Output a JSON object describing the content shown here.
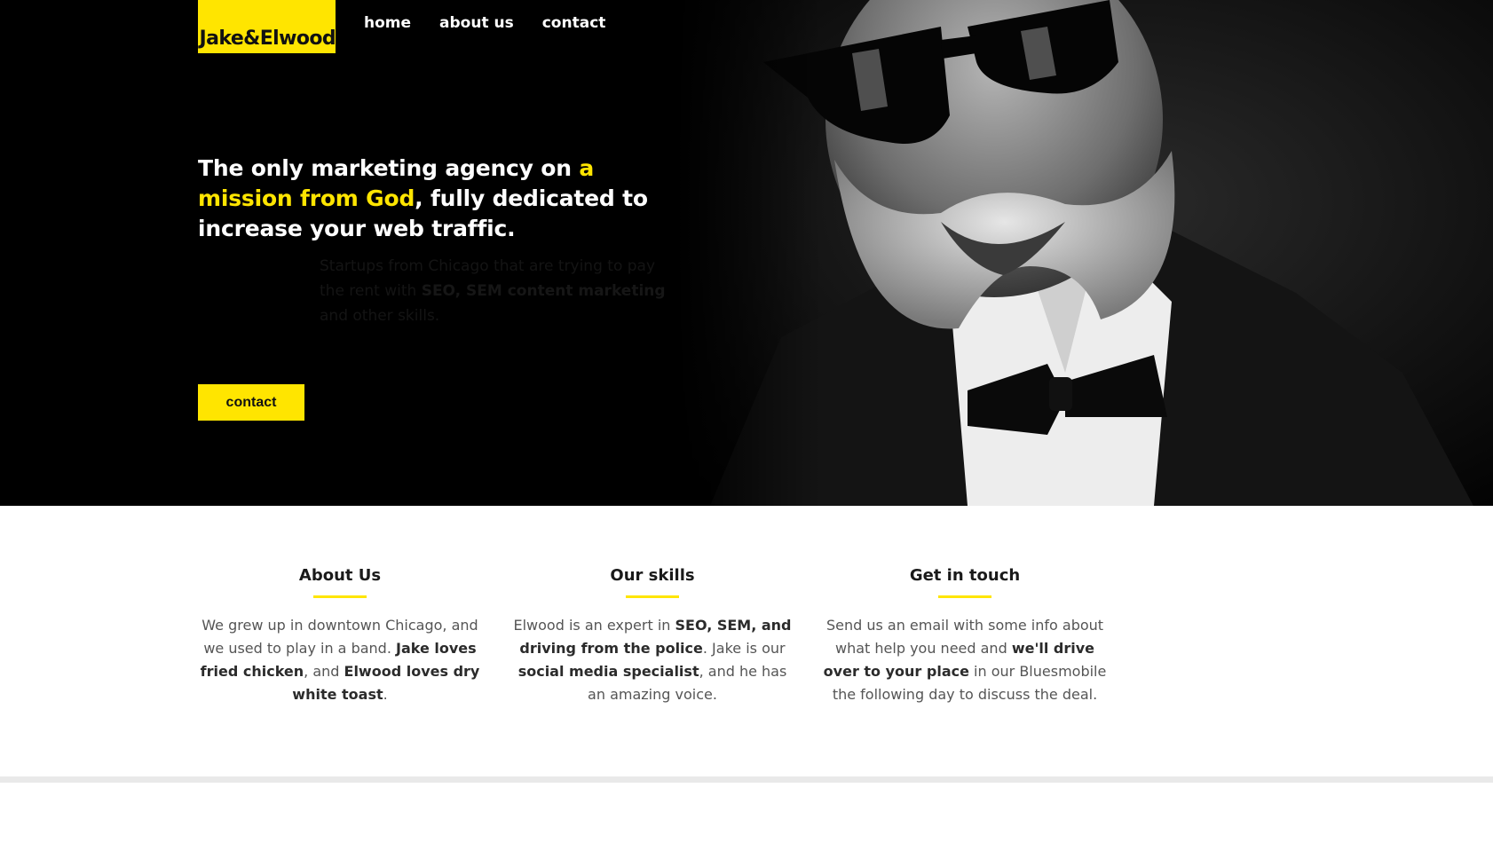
{
  "brand": {
    "logo": "Jake&Elwood",
    "accent": "#ffe500"
  },
  "nav": [
    {
      "label": "home"
    },
    {
      "label": "about us"
    },
    {
      "label": "contact"
    }
  ],
  "hero": {
    "headline_parts": [
      "The only marketing agency on ",
      "a mission from God",
      ", fully dedicated to increase your web traffic."
    ],
    "ghost_parts": [
      "Startups from Chicago that are trying to pay the rent with ",
      "SEO, SEM content marketing",
      " and other skills."
    ],
    "cta": "contact"
  },
  "features": [
    {
      "title": "About Us",
      "parts": [
        "We grew up in downtown Chicago, and we used to play in a band. ",
        "Jake loves fried chicken",
        ", and ",
        "Elwood loves dry white toast",
        "."
      ]
    },
    {
      "title": "Our skills",
      "parts": [
        "Elwood is an expert in ",
        "SEO, SEM, and driving from the police",
        ". Jake is our ",
        "social media specialist",
        ", and he has an amazing voice."
      ]
    },
    {
      "title": "Get in touch",
      "parts": [
        "Send us an email with some info about what help you need and ",
        "we'll drive over to your place",
        " in our Bluesmobile the following day to discuss the deal."
      ]
    }
  ]
}
